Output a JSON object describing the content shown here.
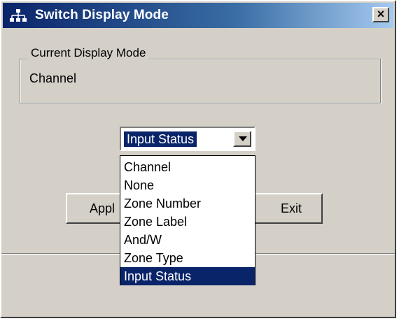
{
  "window": {
    "title": "Switch Display Mode",
    "close_label": "×"
  },
  "current_mode": {
    "legend": "Current Display Mode",
    "value": "Channel"
  },
  "display_select": {
    "selected": "Input Status",
    "options": [
      "Channel",
      "None",
      "Zone Number",
      "Zone Label",
      "And/W",
      "Zone Type",
      "Input Status"
    ],
    "highlighted_index": 6
  },
  "buttons": {
    "apply": "Appl",
    "exit": "Exit"
  },
  "colors": {
    "titlebar_start": "#0a246a",
    "titlebar_end": "#a6caf0",
    "selection": "#0a246a",
    "face": "#d4d0c8"
  },
  "icons": {
    "app": "network-tree-icon",
    "close": "close-icon",
    "dropdown": "chevron-down-icon"
  }
}
